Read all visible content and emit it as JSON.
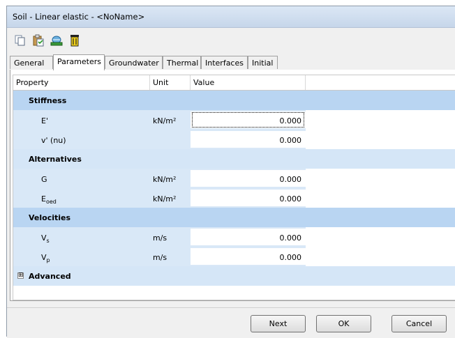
{
  "window": {
    "title": "Soil - Linear elastic - <NoName>"
  },
  "toolbar": {
    "buttons": [
      {
        "icon": "copy-icon"
      },
      {
        "icon": "paste-icon"
      },
      {
        "icon": "database-icon"
      },
      {
        "icon": "delete-icon"
      }
    ]
  },
  "tabs": [
    "General",
    "Parameters",
    "Groundwater",
    "Thermal",
    "Interfaces",
    "Initial"
  ],
  "active_tab": "Parameters",
  "grid": {
    "headers": {
      "property": "Property",
      "unit": "Unit",
      "value": "Value"
    },
    "groups": [
      {
        "label": "Stiffness",
        "rows": [
          {
            "prop": "E'",
            "unit": "kN/m²",
            "value": "0.000"
          },
          {
            "prop": "v' (nu)",
            "unit": "",
            "value": "0.000"
          }
        ]
      },
      {
        "label": "Alternatives",
        "rows": [
          {
            "prop": "G",
            "unit": "kN/m²",
            "value": "0.000"
          },
          {
            "prop": "E",
            "sub": "oed",
            "unit": "kN/m²",
            "value": "0.000"
          }
        ]
      },
      {
        "label": "Velocities",
        "rows": [
          {
            "prop": "V",
            "sub": "s",
            "unit": "m/s",
            "value": "0.000"
          },
          {
            "prop": "V",
            "sub": "p",
            "unit": "m/s",
            "value": "0.000"
          }
        ]
      },
      {
        "label": "Advanced",
        "expander": "⊞"
      }
    ]
  },
  "footer": {
    "next": "Next",
    "ok": "OK",
    "cancel": "Cancel"
  }
}
